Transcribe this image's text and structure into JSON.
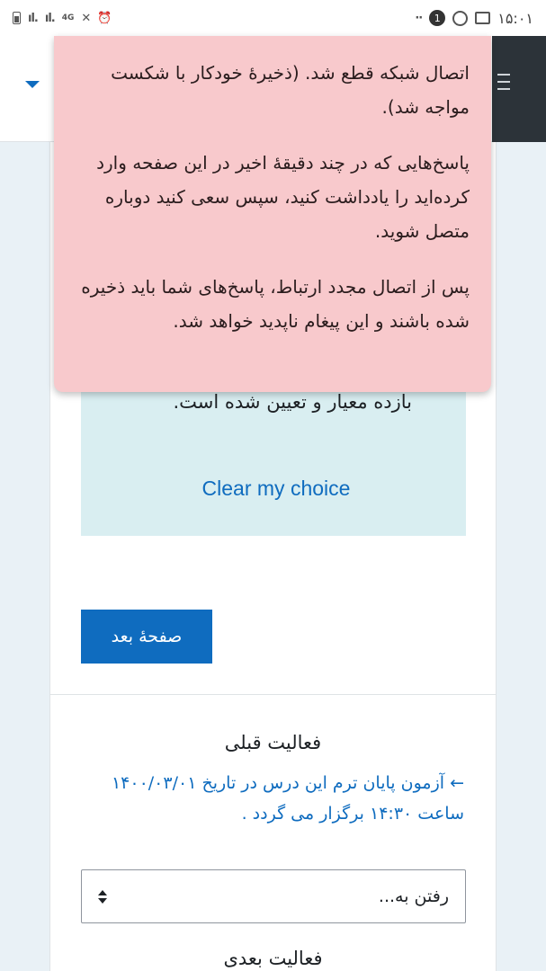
{
  "status_bar": {
    "network_label": "4G",
    "notification_count": "1",
    "time": "۱۵:۰۱"
  },
  "toast": {
    "message_1": "اتصال شبکه قطع شد. (ذخیرهٔ خودکار با شکست مواجه شد).",
    "message_2": "پاسخ‌هایی که در چند دقیقهٔ اخیر در این صفحه وارد کرده‌اید را یادداشت کنید، سپس سعی کنید دوباره متصل شوید.",
    "message_3": "پس از اتصال مجدد ارتباط، پاسخ‌های شما باید ذخیره شده باشند و این پیغام ناپدید خواهد شد."
  },
  "question": {
    "answer_text": "بازده معیار و تعیین شده است.",
    "clear_choice": "Clear my choice"
  },
  "navigation": {
    "next_page": "صفحهٔ بعد"
  },
  "activity": {
    "previous_title": "فعالیت قبلی",
    "previous_link": "← آزمون پایان ترم این درس در تاریخ ۱۴۰۰/۰۳/۰۱ ساعت ۱۴:۳۰ برگزار می گردد .",
    "jump_to": "رفتن به...",
    "next_title": "فعالیت بعدی"
  },
  "colors": {
    "accent": "#0f6cbf",
    "toast_bg": "#f8c9cc",
    "answer_bg": "#d9eef1"
  }
}
